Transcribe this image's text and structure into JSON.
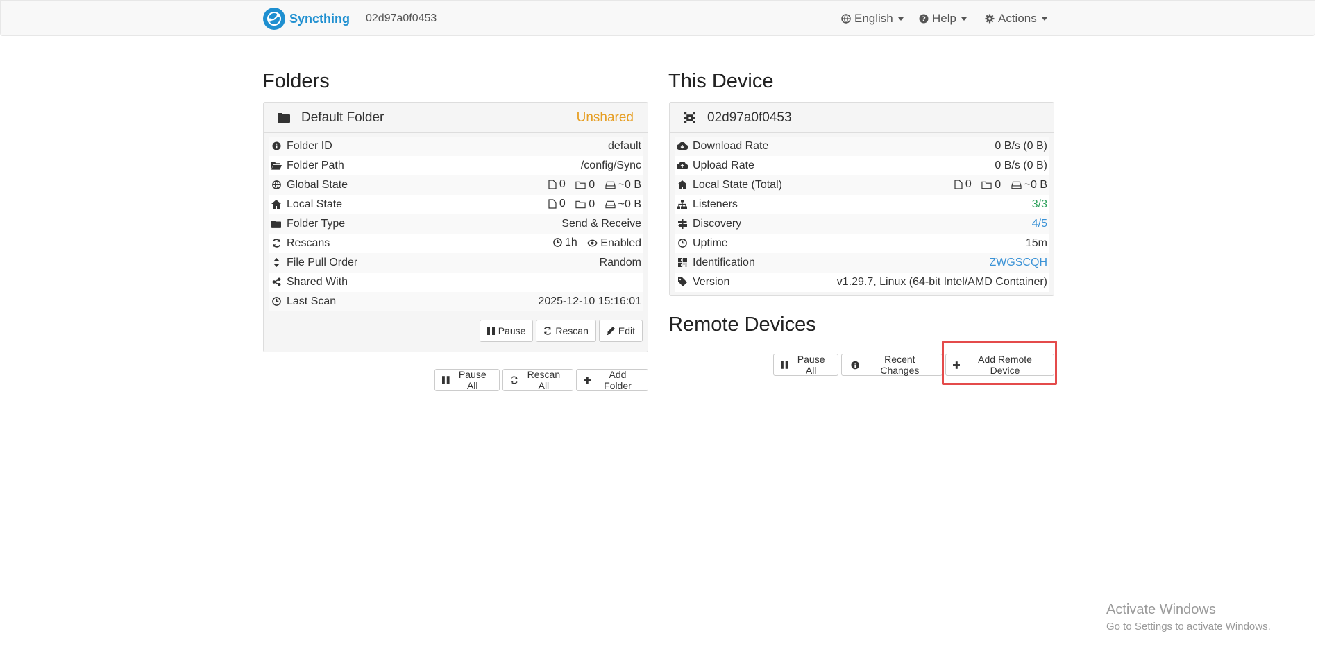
{
  "navbar": {
    "brand": "Syncthing",
    "device_id": "02d97a0f0453",
    "language": "English",
    "help": "Help",
    "actions": "Actions"
  },
  "folders": {
    "heading": "Folders",
    "folder": {
      "name": "Default Folder",
      "status": "Unshared",
      "rows": [
        {
          "icon": "info-circle-icon",
          "label": "Folder ID",
          "value": "default"
        },
        {
          "icon": "folder-open-icon",
          "label": "Folder Path",
          "value": "/config/Sync"
        },
        {
          "icon": "globe-icon",
          "label": "Global State",
          "files": "0",
          "dirs": "0",
          "size": "~0 B"
        },
        {
          "icon": "home-icon",
          "label": "Local State",
          "files": "0",
          "dirs": "0",
          "size": "~0 B"
        },
        {
          "icon": "folder-icon",
          "label": "Folder Type",
          "value": "Send & Receive"
        },
        {
          "icon": "refresh-icon",
          "label": "Rescans",
          "interval": "1h",
          "watcher": "Enabled"
        },
        {
          "icon": "sort-icon",
          "label": "File Pull Order",
          "value": "Random"
        },
        {
          "icon": "share-icon",
          "label": "Shared With",
          "value": ""
        },
        {
          "icon": "clock-icon",
          "label": "Last Scan",
          "value": "2025-12-10 15:16:01"
        }
      ],
      "buttons": {
        "pause": "Pause",
        "rescan": "Rescan",
        "edit": "Edit"
      }
    },
    "buttons": {
      "pause_all": "Pause All",
      "rescan_all": "Rescan All",
      "add_folder": "Add Folder"
    }
  },
  "this_device": {
    "heading": "This Device",
    "name": "02d97a0f0453",
    "rows": [
      {
        "icon": "cloud-download-icon",
        "label": "Download Rate",
        "value": "0 B/s (0 B)"
      },
      {
        "icon": "cloud-upload-icon",
        "label": "Upload Rate",
        "value": "0 B/s (0 B)"
      },
      {
        "icon": "home-icon",
        "label": "Local State (Total)",
        "files": "0",
        "dirs": "0",
        "size": "~0 B"
      },
      {
        "icon": "sitemap-icon",
        "label": "Listeners",
        "value": "3/3",
        "color": "#2ca05a"
      },
      {
        "icon": "signpost-icon",
        "label": "Discovery",
        "value": "4/5",
        "color": "#3a92d6"
      },
      {
        "icon": "clock-icon",
        "label": "Uptime",
        "value": "15m"
      },
      {
        "icon": "qrcode-icon",
        "label": "Identification",
        "value": "ZWGSCQH",
        "color": "#3a92d6"
      },
      {
        "icon": "tag-icon",
        "label": "Version",
        "value": "v1.29.7, Linux (64-bit Intel/AMD Container)"
      }
    ]
  },
  "remote_devices": {
    "heading": "Remote Devices",
    "buttons": {
      "pause_all": "Pause All",
      "recent_changes": "Recent Changes",
      "add_remote_device": "Add Remote Device"
    }
  },
  "watermark": {
    "line1": "Activate Windows",
    "line2": "Go to Settings to activate Windows."
  },
  "colors": {
    "brand": "#1e8fd0",
    "unshared": "#e69e23",
    "highlight": "#e44b4b"
  }
}
